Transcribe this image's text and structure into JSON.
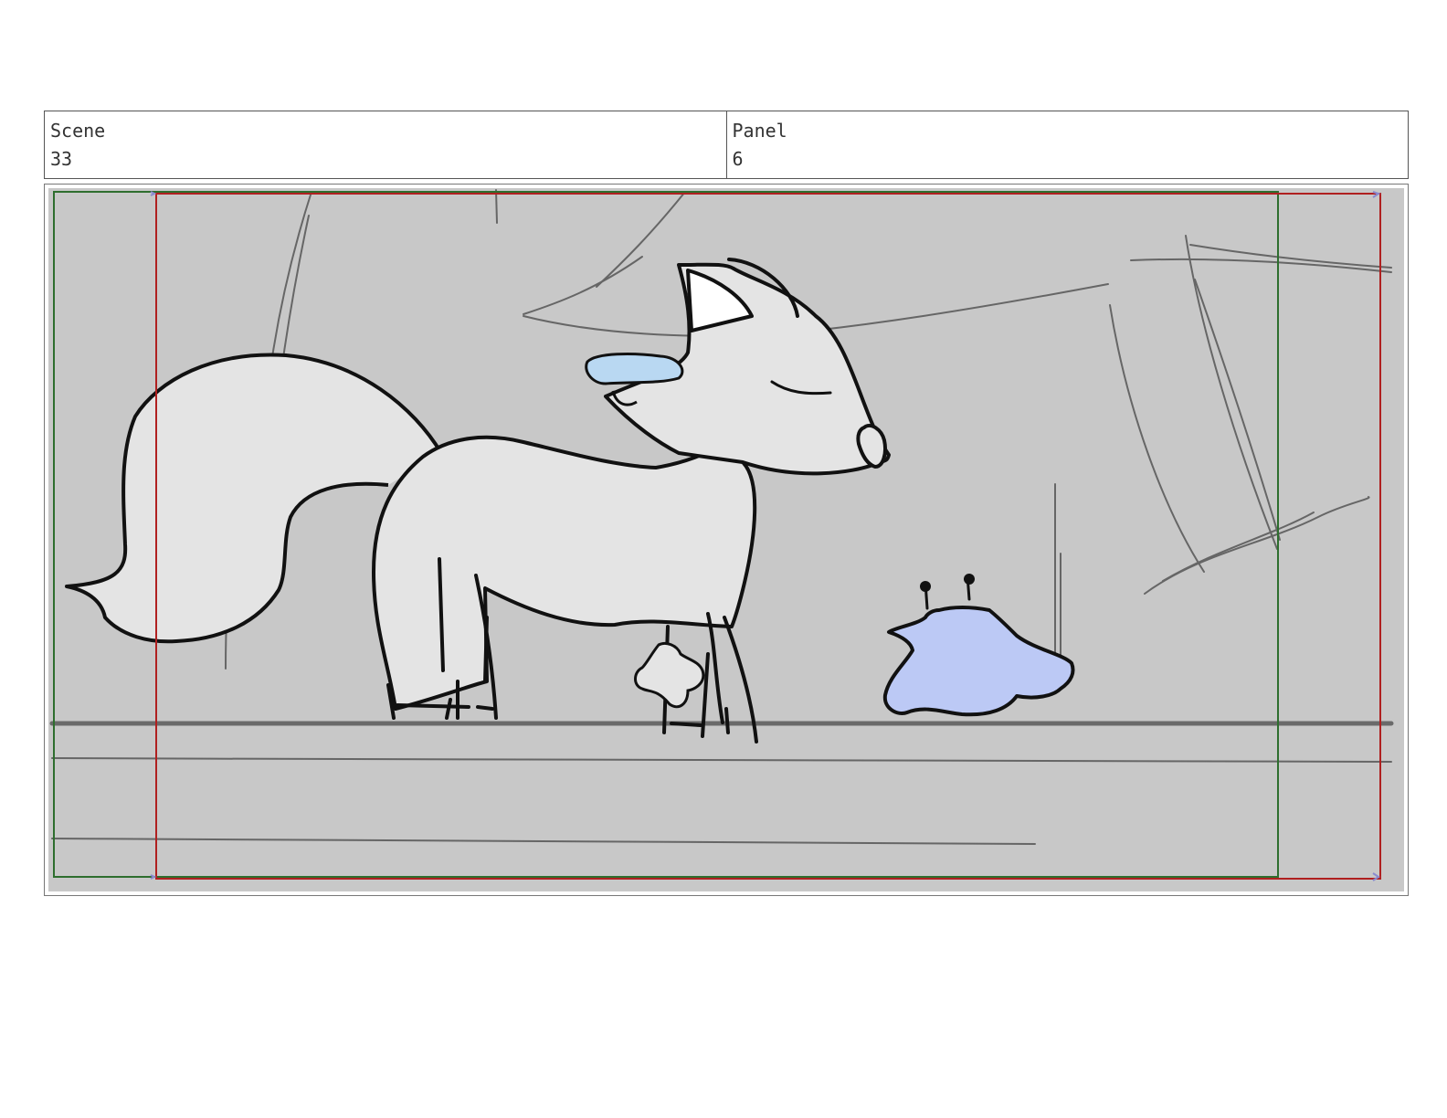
{
  "header": {
    "scene_label": "Scene",
    "scene_value": "33",
    "panel_label": "Panel",
    "panel_value": "6"
  },
  "colors": {
    "background_sketch": "#c8c8c8",
    "character_fill": "#e4e4e4",
    "blue_accent": "#bcc9f5",
    "light_blue_accent": "#b9d8f2",
    "safe_frame_green": "#2e6e2e",
    "camera_frame_red": "#b02020"
  }
}
